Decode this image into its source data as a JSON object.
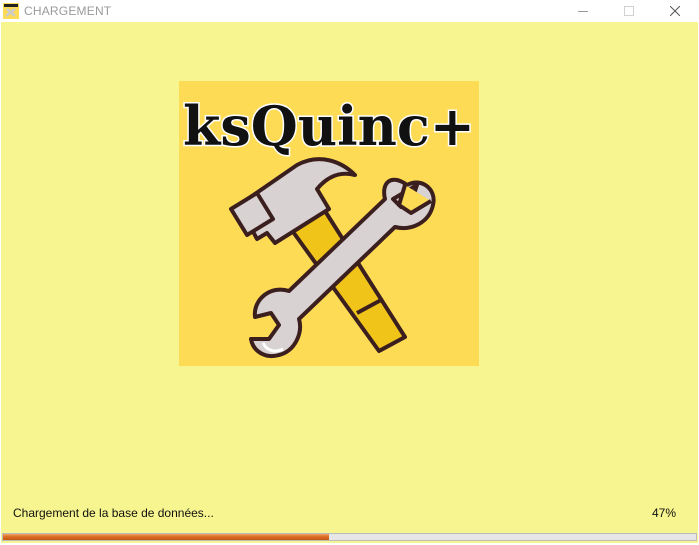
{
  "window": {
    "title": "CHARGEMENT",
    "icon": "ksquinc-icon",
    "controls": [
      "minimize-icon",
      "maximize-icon",
      "close-icon"
    ]
  },
  "logo": {
    "text": "ksQuinc+",
    "image": "hammer-and-wrench"
  },
  "status": {
    "message": "Chargement de la base de données...",
    "percent_label": "47%",
    "progress": 0.47
  },
  "colors": {
    "background": "#f7f58f",
    "logo_background": "#fedb55",
    "progress_fill": "#d96a20"
  }
}
